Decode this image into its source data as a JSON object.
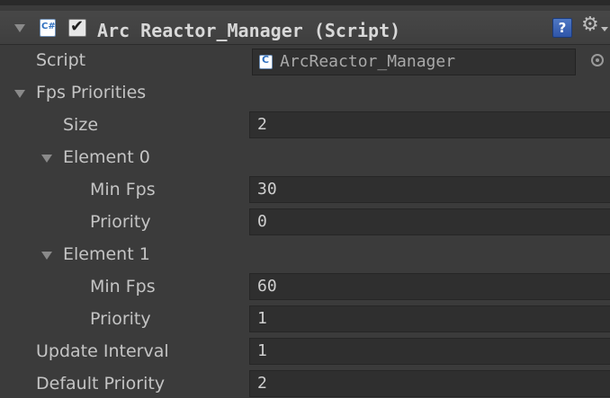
{
  "component": {
    "title": "Arc Reactor_Manager (Script)",
    "enabled": true,
    "icons": {
      "fold": "foldout-arrow-icon",
      "script": "csharp-script-icon",
      "help": "help-book-icon",
      "settings": "gear-icon"
    }
  },
  "fields": {
    "script_label": "Script",
    "script_value": "ArcReactor_Manager",
    "fps_priorities_label": "Fps Priorities",
    "size_label": "Size",
    "size_value": "2",
    "elements": [
      {
        "label": "Element 0",
        "min_fps_label": "Min Fps",
        "min_fps_value": "30",
        "priority_label": "Priority",
        "priority_value": "0"
      },
      {
        "label": "Element 1",
        "min_fps_label": "Min Fps",
        "min_fps_value": "60",
        "priority_label": "Priority",
        "priority_value": "1"
      }
    ],
    "update_interval_label": "Update Interval",
    "update_interval_value": "1",
    "default_priority_label": "Default Priority",
    "default_priority_value": "2"
  }
}
